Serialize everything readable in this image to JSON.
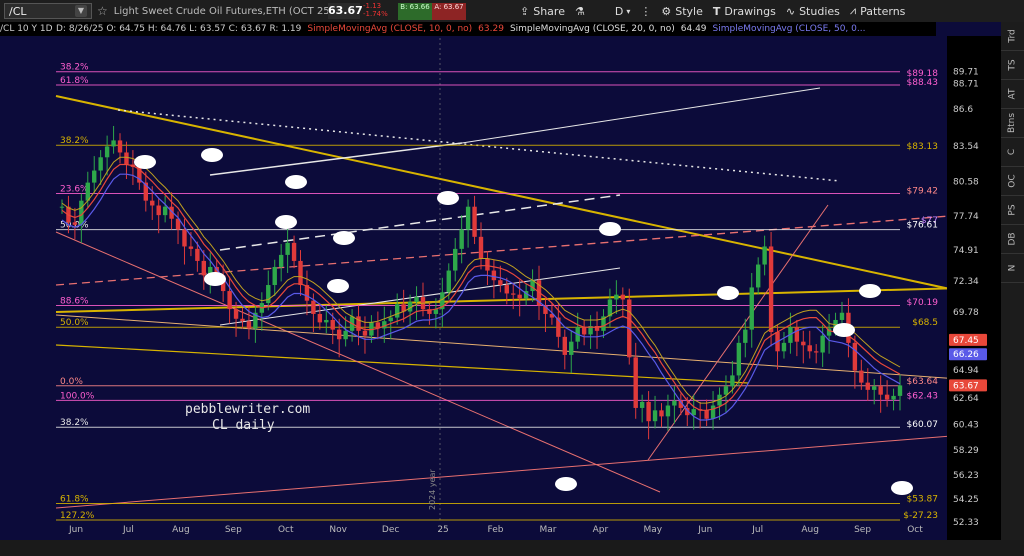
{
  "toolbar": {
    "symbol": "/CL",
    "instrument_title": "Light Sweet Crude Oil Futures,ETH (OCT 25)",
    "last_price": "63.67",
    "change": "-1.13",
    "change_pct": "-1.74%",
    "bid_label": "B: 63.66",
    "ask_label": "A: 63.67",
    "share_label": "Share",
    "period_label": "D",
    "style_label": "Style",
    "drawings_label": "Drawings",
    "studies_label": "Studies",
    "patterns_label": "Patterns"
  },
  "header": {
    "chart_label": "/CL 10 Y 1D",
    "ohlc": "D: 8/26/25  O: 64.75  H: 64.76  L: 63.57  C: 63.67  R: 1.19",
    "sma10": "SimpleMovingAvg (CLOSE, 10, 0, no)",
    "sma10_val": "63.29",
    "sma20": "SimpleMovingAvg (CLOSE, 20, 0, no)",
    "sma20_val": "64.49",
    "sma50": "SimpleMovingAvg (CLOSE, 50, 0..."
  },
  "sidebar": [
    "Trd",
    "TS",
    "AT",
    "Btns",
    "C",
    "OC",
    "PS",
    "DB",
    "N"
  ],
  "watermark": [
    "pebblewriter.com",
    "CL daily"
  ],
  "year_marker": "2024 year",
  "colors": {
    "background": "#0c0b3a",
    "yellow": "#d8b400",
    "white": "#e8e8e8",
    "pink": "#ff5fd0",
    "red": "#e8483a",
    "blue_ma": "#5a5ae8",
    "orange": "#e88a6a",
    "up": "#2ea84a",
    "down": "#e03a3a"
  },
  "chart_data": {
    "type": "candlestick",
    "title": "",
    "ylim": [
      52.5,
      92.5
    ],
    "y_ticks": [
      "89.71",
      "88.71",
      "86.6",
      "83.54",
      "80.58",
      "77.74",
      "74.91",
      "72.34",
      "69.78",
      "67.23",
      "64.94",
      "62.64",
      "60.43",
      "58.29",
      "56.23",
      "54.25",
      "52.33"
    ],
    "x_tick_labels": [
      "Jun",
      "Jul",
      "Aug",
      "Sep",
      "Oct",
      "Nov",
      "Dec",
      "25",
      "Feb",
      "Mar",
      "Apr",
      "May",
      "Jun",
      "Jul",
      "Aug",
      "Sep",
      "Oct"
    ],
    "fib_left": [
      {
        "label": "38.2%",
        "value": 89.7
      },
      {
        "label": "61.8%",
        "value": 88.6
      },
      {
        "label": "38.2%",
        "value": 83.6
      },
      {
        "label": "23.6%",
        "value": 79.6
      },
      {
        "label": "50.0%",
        "value": 76.6
      },
      {
        "label": "88.6%",
        "value": 70.3
      },
      {
        "label": "50.0%",
        "value": 68.5
      },
      {
        "label": "0.0%",
        "value": 63.64
      },
      {
        "label": "100.0%",
        "value": 62.43
      },
      {
        "label": "38.2%",
        "value": 60.2
      },
      {
        "label": "61.8%",
        "value": 53.87
      },
      {
        "label": "127.2%",
        "value": 52.5
      }
    ],
    "price_labels_right": [
      {
        "label": "$89.18",
        "value": 89.18,
        "color": "#ff5fd0"
      },
      {
        "label": "$88.43",
        "value": 88.43,
        "color": "#ff5fd0"
      },
      {
        "label": "$83.13",
        "value": 83.13,
        "color": "#d8b400"
      },
      {
        "label": "$79.42",
        "value": 79.42,
        "color": "#ff8888"
      },
      {
        "label": "$77",
        "value": 77.0,
        "color": "#cc88ff"
      },
      {
        "label": "$76.61",
        "value": 76.61,
        "color": "#ffffff"
      },
      {
        "label": "$70.19",
        "value": 70.19,
        "color": "#ff5fd0"
      },
      {
        "label": "$68.5",
        "value": 68.5,
        "color": "#d8b400"
      },
      {
        "label": "$63.64",
        "value": 63.64,
        "color": "#ff8888"
      },
      {
        "label": "$62.43",
        "value": 62.43,
        "color": "#ff5fd0"
      },
      {
        "label": "$60.07",
        "value": 60.07,
        "color": "#ffffff"
      },
      {
        "label": "$53.87",
        "value": 53.87,
        "color": "#d8b400"
      },
      {
        "label": "$-27.23",
        "value": 52.5,
        "color": "#d8b400"
      }
    ],
    "axis_badges": [
      {
        "label": "67.45",
        "value": 67.45,
        "color": "#e8483a"
      },
      {
        "label": "66.26",
        "value": 66.26,
        "color": "#5a5ae8"
      },
      {
        "label": "63.67",
        "value": 63.67,
        "color": "#e8483a"
      }
    ],
    "closes": [
      78.5,
      77.2,
      77.0,
      79.0,
      80.5,
      81.5,
      82.6,
      83.5,
      84.0,
      83.0,
      82.0,
      81.8,
      80.5,
      79.0,
      78.6,
      77.8,
      78.5,
      77.5,
      76.6,
      75.2,
      75.0,
      74.0,
      72.8,
      73.5,
      72.8,
      71.5,
      70.0,
      69.2,
      69.0,
      68.4,
      69.7,
      70.5,
      72.0,
      73.5,
      74.5,
      75.5,
      74.0,
      72.0,
      70.7,
      69.6,
      68.9,
      69.1,
      68.3,
      67.5,
      68.2,
      69.4,
      68.2,
      67.8,
      68.9,
      68.4,
      69.0,
      69.3,
      70.4,
      69.8,
      70.6,
      71.0,
      70.0,
      69.6,
      70.0,
      71.4,
      73.2,
      75.0,
      76.6,
      78.5,
      76.0,
      74.2,
      73.2,
      72.4,
      72.0,
      71.3,
      71.2,
      70.9,
      71.5,
      72.4,
      70.3,
      69.6,
      69.3,
      67.7,
      66.2,
      67.3,
      68.5,
      67.9,
      68.6,
      68.2,
      69.4,
      70.8,
      71.2,
      70.8,
      66.0,
      61.8,
      62.3,
      60.7,
      61.6,
      61.1,
      62.0,
      62.4,
      61.8,
      61.2,
      61.7,
      61.6,
      60.9,
      62.0,
      62.9,
      63.6,
      64.5,
      67.2,
      68.3,
      71.8,
      73.7,
      75.2,
      68.1,
      66.5,
      67.2,
      68.5,
      67.3,
      67.0,
      66.5,
      66.4,
      67.8,
      68.4,
      69.1,
      69.7,
      67.2,
      64.9,
      63.9,
      63.3,
      63.6,
      62.9,
      62.5,
      62.8,
      63.67
    ],
    "ma10": [
      78.2,
      77.8,
      77.6,
      77.8,
      78.4,
      79.1,
      79.9,
      80.8,
      81.6,
      82.0,
      82.0,
      81.9,
      81.6,
      81.1,
      80.6,
      80.0,
      79.5,
      78.9,
      78.4,
      77.6,
      76.9,
      76.2,
      75.4,
      74.8,
      74.1,
      73.4,
      72.6,
      71.8,
      71.1,
      70.6,
      70.3,
      70.1,
      70.2,
      70.6,
      71.2,
      71.8,
      72.1,
      72.1,
      71.9,
      71.6,
      71.2,
      70.7,
      70.2,
      69.6,
      69.1,
      68.8,
      68.5,
      68.3,
      68.3,
      68.4,
      68.6,
      68.8,
      69.0,
      69.2,
      69.5,
      69.8,
      69.9,
      69.9,
      70.0,
      70.2,
      70.6,
      71.3,
      72.1,
      73.0,
      73.5,
      73.6,
      73.6,
      73.5,
      73.4,
      73.2,
      72.9,
      72.5,
      72.1,
      71.8,
      71.4,
      71.0,
      70.5,
      69.9,
      69.3,
      69.0,
      68.7,
      68.5,
      68.5,
      68.5,
      68.6,
      68.9,
      69.2,
      69.4,
      69.2,
      68.6,
      67.9,
      67.1,
      66.4,
      65.5,
      64.7,
      63.9,
      63.1,
      62.4,
      61.9,
      61.6,
      61.6,
      61.7,
      61.9,
      62.2,
      62.7,
      63.4,
      64.2,
      65.2,
      66.3,
      67.4,
      67.8,
      68.1,
      68.4,
      68.7,
      69.0,
      69.2,
      69.3,
      69.3,
      68.8,
      68.2,
      68.1,
      68.0,
      67.8,
      67.4,
      66.9,
      66.4,
      65.9,
      65.5,
      65.2,
      64.9,
      64.6
    ]
  }
}
